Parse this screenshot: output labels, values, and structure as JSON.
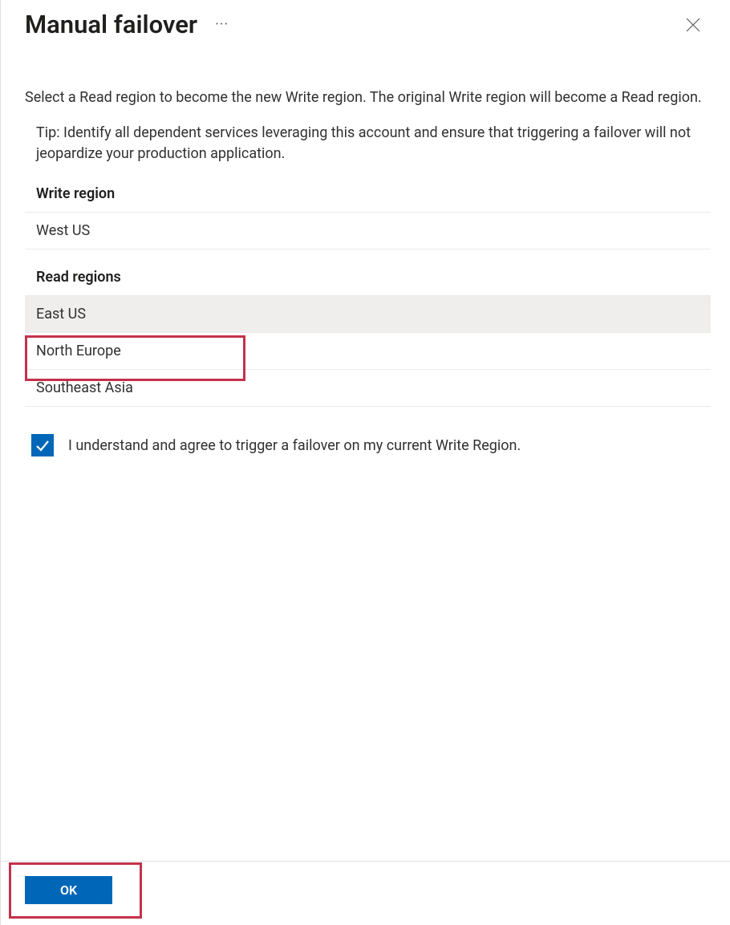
{
  "header": {
    "title": "Manual failover"
  },
  "instruction": "Select a Read region to become the new Write region. The original Write region will become a Read region.",
  "tip": "Tip: Identify all dependent services leveraging this account and ensure that triggering a failover will not jeopardize your production application.",
  "writeRegionHeader": "Write region",
  "writeRegion": "West US",
  "readRegionsHeader": "Read regions",
  "readRegions": [
    {
      "name": "East US",
      "selected": true
    },
    {
      "name": "North Europe",
      "selected": false
    },
    {
      "name": "Southeast Asia",
      "selected": false
    }
  ],
  "consent": {
    "checked": true,
    "text": "I understand and agree to trigger a failover on my current Write Region."
  },
  "footer": {
    "ok": "OK"
  }
}
